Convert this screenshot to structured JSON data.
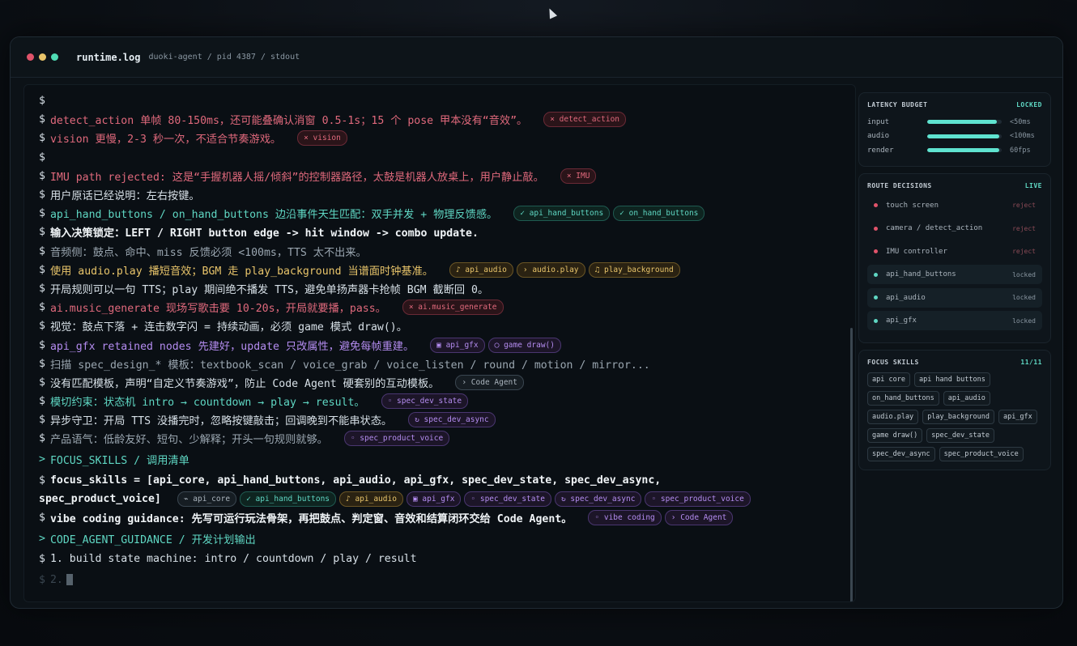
{
  "window": {
    "title": "runtime.log",
    "subtitle": "duoki-agent / pid 4387 / stdout"
  },
  "terminal": {
    "lines": [
      {
        "kind": "plain",
        "text": ""
      },
      {
        "kind": "red",
        "text": "detect_action 单帧 80-150ms，还可能叠确认消窗 0.5-1s；15 个 pose 甲本没有“音效”。",
        "tags": [
          {
            "style": "red",
            "label": "× detect_action"
          }
        ]
      },
      {
        "kind": "red",
        "text": "vision 更慢，2-3 秒一次，不适合节奏游戏。",
        "tags": [
          {
            "style": "red",
            "label": "× vision"
          }
        ]
      },
      {
        "kind": "plain",
        "text": ""
      },
      {
        "kind": "red",
        "text": "IMU path rejected: 这是“手握机器人摇/倾斜”的控制器路径，太鼓是机器人放桌上，用户静止敲。",
        "tags": [
          {
            "style": "red",
            "label": "× IMU"
          }
        ]
      },
      {
        "kind": "plain",
        "text": "用户原话已经说明：左右按键。",
        "tags": []
      },
      {
        "kind": "teal",
        "text": "api_hand_buttons / on_hand_buttons 边沿事件天生匹配：双手并发 + 物理反馈感。",
        "tags": [
          {
            "style": "teal",
            "label": "✓ api_hand_buttons"
          },
          {
            "style": "teal",
            "label": "✓ on_hand_buttons"
          }
        ]
      },
      {
        "kind": "bold",
        "text": "输入决策锁定：LEFT / RIGHT button edge -> hit window -> combo update.",
        "tags": []
      },
      {
        "kind": "dim",
        "text": "音频侧：鼓点、命中、miss 反馈必须 <100ms，TTS 太不出来。",
        "tags": []
      },
      {
        "kind": "yellow",
        "text": "使用 audio.play 播短音效；BGM 走 play_background 当谱面时钟基准。",
        "tags": [
          {
            "style": "yellow",
            "label": "♪ api_audio"
          },
          {
            "style": "yellow",
            "label": "› audio.play"
          },
          {
            "style": "yellow",
            "label": "♫ play_background"
          }
        ]
      },
      {
        "kind": "plain",
        "text": "开局规则可以一句 TTS；play 期间绝不播发 TTS，避免单扬声器卡抢帧 BGM 截断回 0。",
        "tags": []
      },
      {
        "kind": "red",
        "text": "ai.music_generate 现场写歌击要 10-20s，开局就要播，pass。",
        "tags": [
          {
            "style": "red",
            "label": "× ai.music_generate"
          }
        ]
      },
      {
        "kind": "plain",
        "text": "视觉：鼓点下落 + 连击数字闪 = 持续动画，必须 game 模式 draw()。",
        "tags": []
      },
      {
        "kind": "purple",
        "text": "api_gfx retained nodes 先建好，update 只改属性，避免每帧重建。",
        "tags": [
          {
            "style": "purple",
            "label": "▣ api_gfx"
          },
          {
            "style": "purple",
            "label": "◯ game draw()"
          }
        ]
      },
      {
        "kind": "dim",
        "text": "扫描 spec_design_* 模板：textbook_scan / voice_grab / voice_listen / round / motion / mirror...",
        "tags": []
      },
      {
        "kind": "plain",
        "text": "没有匹配模板，声明“自定义节奏游戏”，防止 Code Agent 硬套别的互动模板。",
        "tags": [
          {
            "style": "gray",
            "label": "› Code Agent"
          }
        ]
      },
      {
        "kind": "teal",
        "text": "模切约束：状态机 intro → countdown → play → result。",
        "tags": [
          {
            "style": "purple",
            "label": "◦ spec_dev_state"
          }
        ]
      },
      {
        "kind": "plain",
        "text": "异步守卫：开局 TTS 没播完时，忽略按键敲击；回调晚到不能串状态。",
        "tags": [
          {
            "style": "purple",
            "label": "↻ spec_dev_async"
          }
        ]
      },
      {
        "kind": "dim",
        "text": "产品语气：低龄友好、短句、少解释；开头一句规则就够。",
        "tags": [
          {
            "style": "purple",
            "label": "◦ spec_product_voice"
          }
        ]
      }
    ],
    "section_focus": "FOCUS_SKILLS / 调用清单",
    "focus_line_1": "focus_skills = [api_core, api_hand_buttons, api_audio, api_gfx, spec_dev_state, spec_dev_async,",
    "focus_line_2": "spec_product_voice]",
    "focus_tags": [
      {
        "style": "gray",
        "label": "⌁ api_core"
      },
      {
        "style": "teal",
        "label": "✓ api_hand_buttons"
      },
      {
        "style": "yellow",
        "label": "♪ api_audio"
      },
      {
        "style": "purple",
        "label": "▣ api_gfx"
      },
      {
        "style": "purple",
        "label": "◦ spec_dev_state"
      },
      {
        "style": "purple",
        "label": "↻ spec_dev_async"
      },
      {
        "style": "purple",
        "label": "◦ spec_product_voice"
      }
    ],
    "vibe_line": "vibe coding guidance: 先写可运行玩法骨架，再把鼓点、判定窗、音效和结算闭环交给 Code Agent。",
    "vibe_tags": [
      {
        "style": "purple",
        "label": "◦ vibe coding"
      },
      {
        "style": "purple",
        "label": "› Code Agent"
      }
    ],
    "section_code": "CODE_AGENT_GUIDANCE / 开发计划输出",
    "plan_line": "1. build state machine: intro / countdown / play / result",
    "next_line": "2."
  },
  "latency": {
    "title": "LATENCY BUDGET",
    "status": "LOCKED",
    "rows": [
      {
        "label": "input",
        "fill": 0.93,
        "value": "<50ms"
      },
      {
        "label": "audio",
        "fill": 0.97,
        "value": "<100ms"
      },
      {
        "label": "render",
        "fill": 0.97,
        "value": "60fps"
      }
    ]
  },
  "routes": {
    "title": "ROUTE DECISIONS",
    "status": "LIVE",
    "items": [
      {
        "label": "touch screen",
        "state": "reject",
        "color": "#e0536a"
      },
      {
        "label": "camera / detect_action",
        "state": "reject",
        "color": "#e0536a"
      },
      {
        "label": "IMU controller",
        "state": "reject",
        "color": "#e0536a"
      },
      {
        "label": "api_hand_buttons",
        "state": "locked",
        "color": "#5fd7c3"
      },
      {
        "label": "api_audio",
        "state": "locked",
        "color": "#5fd7c3"
      },
      {
        "label": "api_gfx",
        "state": "locked",
        "color": "#5fd7c3"
      }
    ]
  },
  "focus": {
    "title": "FOCUS SKILLS",
    "count": "11/11",
    "chips": [
      "api core",
      "api hand buttons",
      "on_hand_buttons",
      "api_audio",
      "audio.play",
      "play_background",
      "api_gfx",
      "game draw()",
      "spec_dev_state",
      "spec_dev_async",
      "spec_product_voice"
    ]
  },
  "colors": {
    "accent": "#5fd7c3",
    "reject": "#e0536a",
    "audio": "#e8c46a",
    "spec": "#b48cf0"
  }
}
